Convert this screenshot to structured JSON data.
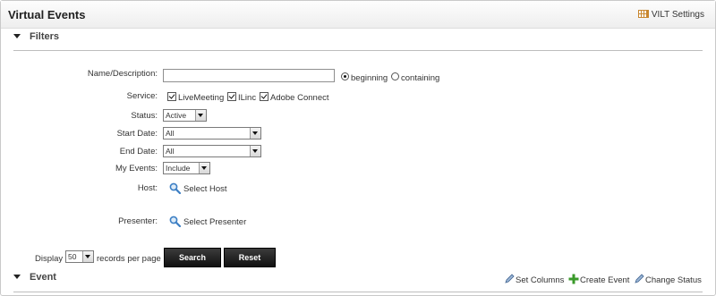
{
  "header": {
    "title": "Virtual Events",
    "vilt_settings": "VILT Settings"
  },
  "filters": {
    "heading": "Filters",
    "name_description": {
      "label": "Name/Description:",
      "value": ""
    },
    "match_mode": {
      "options": [
        "beginning",
        "containing"
      ],
      "selected": "beginning"
    },
    "service": {
      "label": "Service:",
      "options": [
        {
          "label": "LiveMeeting",
          "checked": true
        },
        {
          "label": "ILinc",
          "checked": true
        },
        {
          "label": "Adobe Connect",
          "checked": true
        }
      ]
    },
    "status": {
      "label": "Status:",
      "value": "Active"
    },
    "start_date": {
      "label": "Start Date:",
      "value": "All"
    },
    "end_date": {
      "label": "End Date:",
      "value": "All"
    },
    "my_events": {
      "label": "My Events:",
      "value": "Include"
    },
    "host": {
      "label": "Host:",
      "action": "Select Host"
    },
    "presenter": {
      "label": "Presenter:",
      "action": "Select Presenter"
    }
  },
  "pagination": {
    "display_label": "Display",
    "records_value": "50",
    "records_suffix": "records per page"
  },
  "buttons": {
    "search": "Search",
    "reset": "Reset"
  },
  "event": {
    "heading": "Event",
    "set_columns": "Set Columns",
    "create_event": "Create Event",
    "change_status": "Change Status"
  },
  "colors": {
    "button_bg": "#1e1e1e",
    "divider": "#bdbdbd",
    "magnifier": "#3d7fc4",
    "plus": "#3a9a2a"
  }
}
